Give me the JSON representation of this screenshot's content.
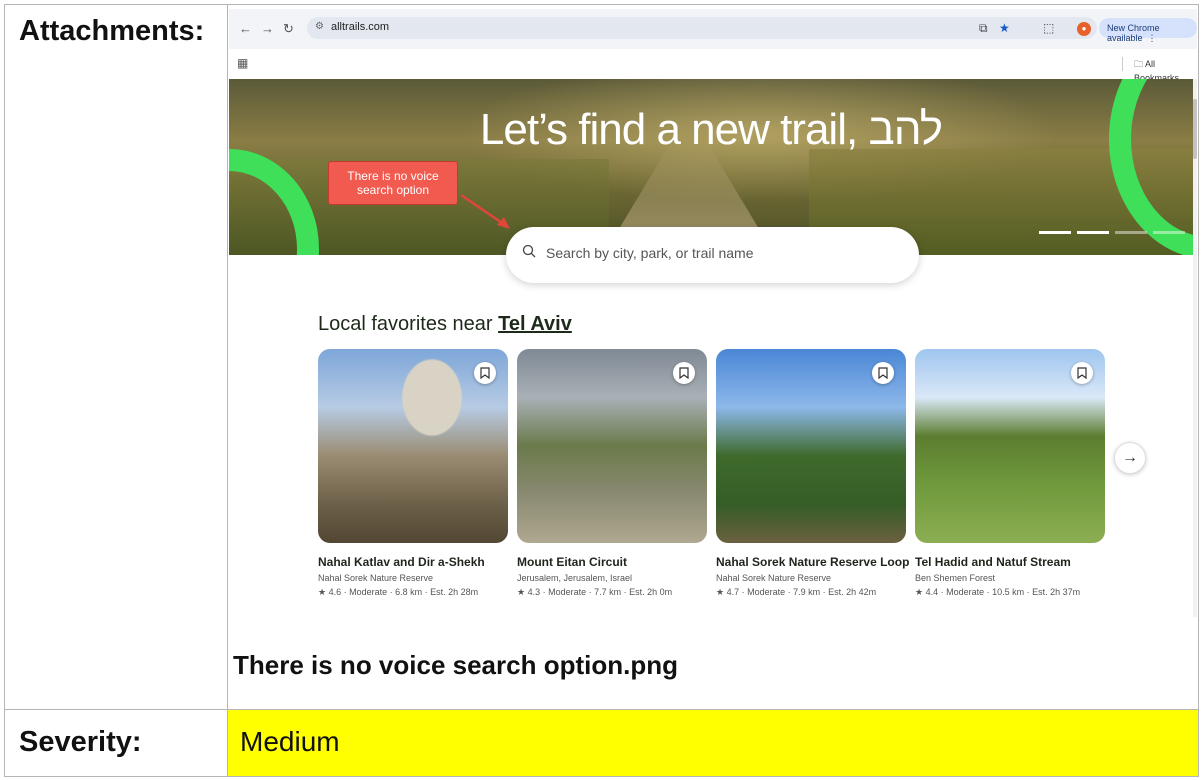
{
  "report": {
    "attachments_label": "Attachments:",
    "caption": "There is no voice search option.png",
    "severity_label": "Severity:",
    "severity_value": "Medium",
    "severity_color": "#ffff00"
  },
  "browser": {
    "url": "alltrails.com",
    "new_chrome_label": "New Chrome available",
    "all_bookmarks_label": "All Bookmarks",
    "nav_icons": [
      "back-arrow-icon",
      "forward-arrow-icon",
      "reload-icon"
    ]
  },
  "page": {
    "hero_title": "Let’s find a new trail, להב",
    "search_placeholder": "Search by city, park, or trail name",
    "section_prefix": "Local favorites near ",
    "section_location": "Tel Aviv",
    "accent_color": "#3fdf5a",
    "trails": [
      {
        "title": "Nahal Katlav and Dir a-Shekh",
        "location": "Nahal Sorek Nature Reserve",
        "meta": "4.6 · Moderate · 6.8 km · Est. 2h 28m"
      },
      {
        "title": "Mount Eitan Circuit",
        "location": "Jerusalem, Jerusalem, Israel",
        "meta": "4.3 · Moderate · 7.7 km · Est. 2h 0m"
      },
      {
        "title": "Nahal Sorek Nature Reserve Loop",
        "location": "Nahal Sorek Nature Reserve",
        "meta": "4.7 · Moderate · 7.9 km · Est. 2h 42m"
      },
      {
        "title": "Tel Hadid and Natuf Stream",
        "location": "Ben Shemen Forest",
        "meta": "4.4 · Moderate · 10.5 km · Est. 2h 37m"
      }
    ]
  },
  "annotation": {
    "text": "There is no voice search option",
    "color": "#f05a4f"
  }
}
